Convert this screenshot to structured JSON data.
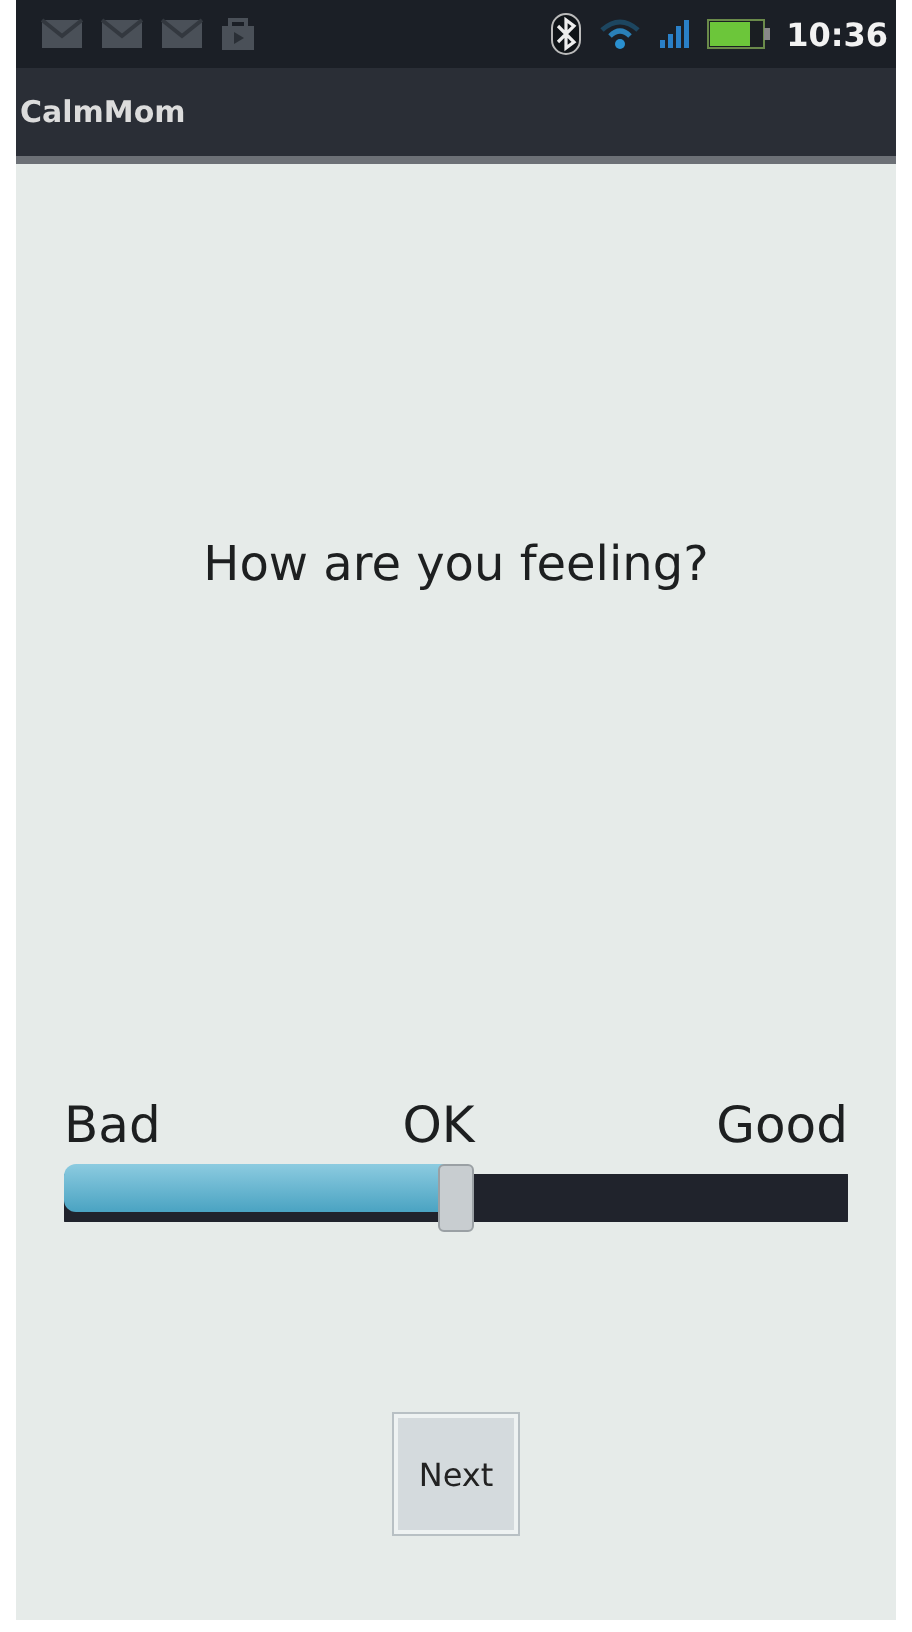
{
  "status_bar": {
    "time": "10:36"
  },
  "app_bar": {
    "title": "CalmMom"
  },
  "question": "How are you feeling?",
  "mood_slider": {
    "labels": [
      "Bad",
      "OK",
      "Good"
    ],
    "level": 0.5
  },
  "buttons": [
    {
      "label": "Next"
    }
  ]
}
